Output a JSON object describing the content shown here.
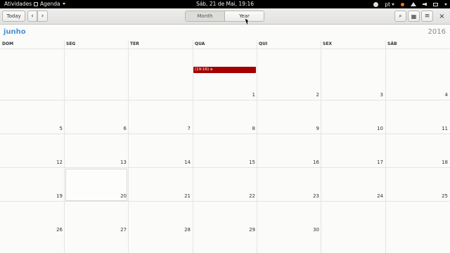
{
  "topbar": {
    "activities": "Atividades",
    "app_name": "Agenda",
    "clock": "Sáb, 21 de Mai, 19:16",
    "lang": "pt"
  },
  "header": {
    "today": "Today",
    "prev": "‹",
    "next": "›",
    "view_month": "Month",
    "view_year": "Year",
    "search": "⌕",
    "calendars": "▦",
    "menu": "≡",
    "close": "×"
  },
  "calendar": {
    "month": "junho",
    "year": "2016",
    "weekdays": [
      "DOM",
      "SEG",
      "TER",
      "QUA",
      "QUI",
      "SEX",
      "SÁB"
    ],
    "days": {
      "d1": "1",
      "d2": "2",
      "d3": "3",
      "d4": "4",
      "d5": "5",
      "d6": "6",
      "d7": "7",
      "d8": "8",
      "d9": "9",
      "d10": "10",
      "d11": "11",
      "d12": "12",
      "d13": "13",
      "d14": "14",
      "d15": "15",
      "d16": "16",
      "d17": "17",
      "d18": "18",
      "d19": "19",
      "d20": "20",
      "d21": "21",
      "d22": "22",
      "d23": "23",
      "d24": "24",
      "d25": "25",
      "d26": "26",
      "d27": "27",
      "d28": "28",
      "d29": "29",
      "d30": "30"
    },
    "event": "(19:16) a"
  },
  "colors": {
    "accent": "#4a90d9",
    "event": "#a40000"
  }
}
